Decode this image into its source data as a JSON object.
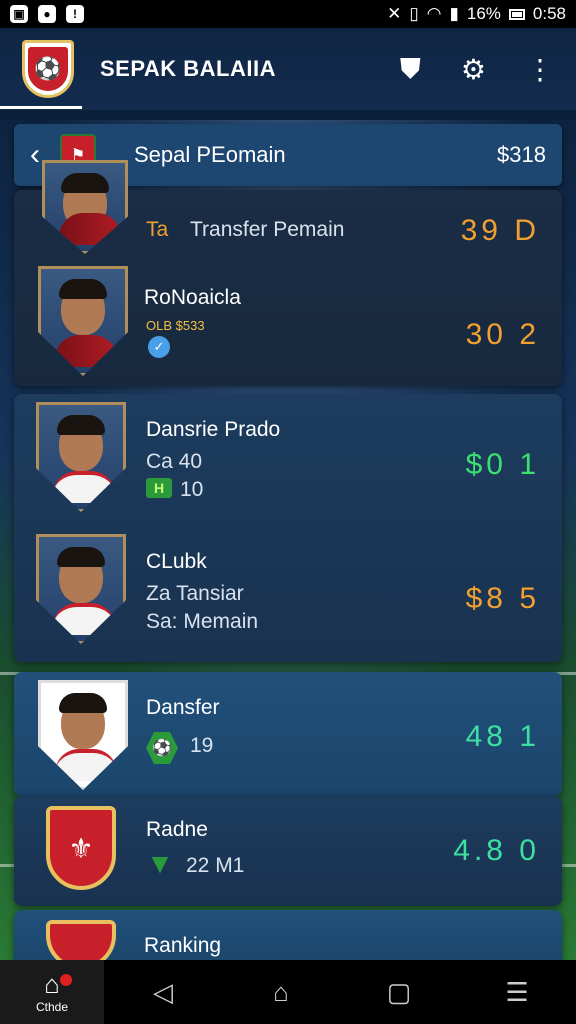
{
  "status_bar": {
    "left_icons": [
      "notification-icon",
      "app-icon",
      "alert-icon"
    ],
    "battery_percent": "16%",
    "time": "0:58"
  },
  "app_bar": {
    "title": "SEPAK BALAIIA",
    "actions": [
      "badge-icon",
      "gear-icon",
      "more-icon"
    ]
  },
  "header": {
    "title": "Sepal PEomain",
    "value": "$318"
  },
  "players": [
    {
      "name": "",
      "sub1_prefix": "Ta",
      "sub1": "Transfer Pemain",
      "value": "39 D",
      "value_color": "orange"
    },
    {
      "name": "RoNoaicla",
      "sub1": "OLB  $533",
      "value": "30 2",
      "value_color": "orange"
    },
    {
      "name": "Dansrie Prado",
      "sub1": "Ca  40",
      "sub2": "10",
      "value": "$0 1",
      "value_color": "green"
    },
    {
      "name": "CLubk",
      "sub1": "Za  Tansiar",
      "sub2": "Sa: Memain",
      "value": "$8 5",
      "value_color": "orange"
    },
    {
      "name": "Dansfer",
      "sub1": "19",
      "value": "48 1",
      "value_color": "teal"
    },
    {
      "name": "Radne",
      "sub1": "22 M1",
      "value": "4.8 0",
      "value_color": "teal"
    },
    {
      "name": "Ranking",
      "sub1": "",
      "value": "",
      "value_color": "teal"
    }
  ],
  "bottom_nav": {
    "home_label": "Cthde"
  }
}
